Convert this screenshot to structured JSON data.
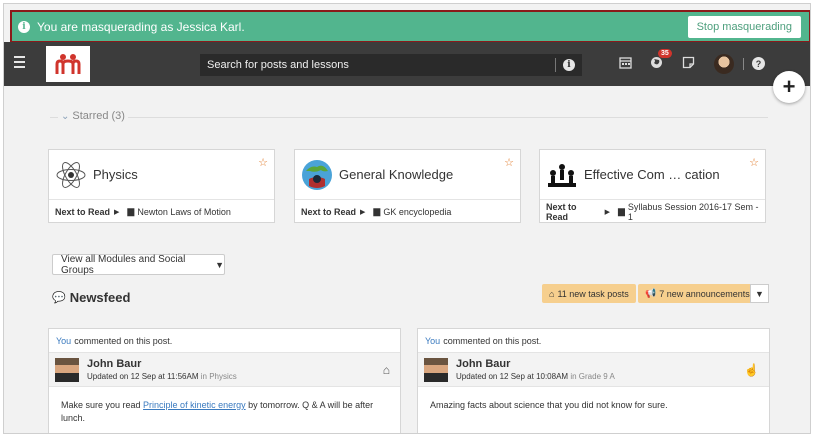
{
  "banner": {
    "message": "You are masquerading as Jessica Karl.",
    "stop_label": "Stop masquerading"
  },
  "topbar": {
    "search_placeholder": "Search for posts and lessons",
    "notification_count": "35"
  },
  "starred": {
    "label": "Starred (3)"
  },
  "cards": [
    {
      "title": "Physics",
      "next_label": "Next to Read",
      "next_item": "Newton Laws of Motion"
    },
    {
      "title": "General Knowledge",
      "next_label": "Next to Read",
      "next_item": "GK encyclopedia"
    },
    {
      "title": "Effective Com … cation",
      "next_label": "Next to Read",
      "next_item": "Syllabus Session 2016-17 Sem - 1"
    }
  ],
  "view_all_label": "View all Modules and Social Groups",
  "newsfeed": {
    "title": "Newsfeed",
    "task_posts": "11 new task posts",
    "announcements": "7 new announcements"
  },
  "posts": [
    {
      "you": "You",
      "action": "commented on this post.",
      "author": "John Baur",
      "updated": "Updated on 12 Sep at 11:56AM",
      "in_word": "in",
      "group": "Physics",
      "body_before": "Make sure you read ",
      "body_link": "Principle of kinetic energy",
      "body_after": " by tomorrow. Q & A will be after lunch."
    },
    {
      "you": "You",
      "action": "commented on this post.",
      "author": "John Baur",
      "updated": "Updated on 12 Sep at 10:08AM",
      "in_word": "in",
      "group": "Grade 9 A",
      "body_before": "Amazing facts about science that you did not know for sure."
    }
  ],
  "colors": {
    "banner_bg": "#52b58e",
    "topbar_bg": "#3c3c3c",
    "accent": "#e07a2a",
    "pill_bg": "#f6cf8e",
    "link": "#3a7abf"
  }
}
